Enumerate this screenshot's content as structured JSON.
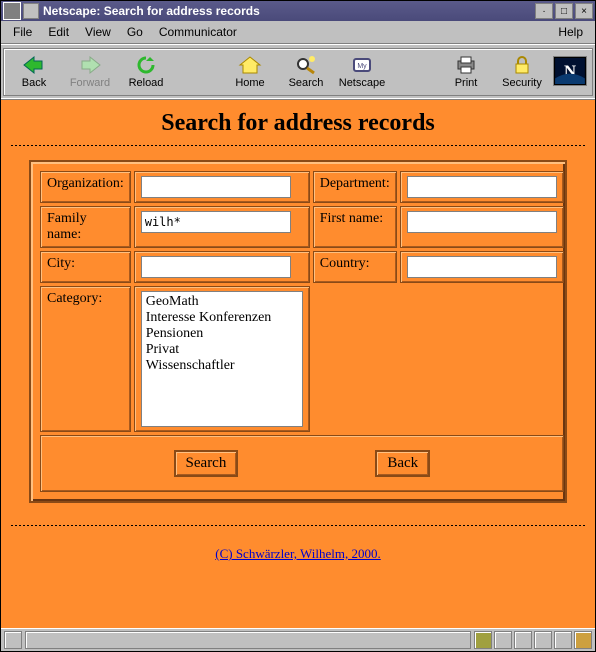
{
  "window": {
    "title": "Netscape: Search for address records"
  },
  "menubar": {
    "file": "File",
    "edit": "Edit",
    "view": "View",
    "go": "Go",
    "communicator": "Communicator",
    "help": "Help"
  },
  "toolbar": {
    "back": "Back",
    "forward": "Forward",
    "reload": "Reload",
    "home": "Home",
    "search": "Search",
    "netscape": "Netscape",
    "print": "Print",
    "security": "Security"
  },
  "page": {
    "title": "Search for address records"
  },
  "form": {
    "labels": {
      "organization": "Organization:",
      "department": "Department:",
      "family_name": "Family name:",
      "first_name": "First name:",
      "city": "City:",
      "country": "Country:",
      "category": "Category:"
    },
    "values": {
      "organization": "",
      "department": "",
      "family_name": "wilh*",
      "first_name": "",
      "city": "",
      "country": ""
    },
    "category_options": [
      "GeoMath",
      "Interesse Konferenzen",
      "Pensionen",
      "Privat",
      "Wissenschaftler"
    ],
    "buttons": {
      "search": "Search",
      "back": "Back"
    }
  },
  "footer": {
    "copyright": "(C) Schwärzler, Wilhelm, 2000."
  }
}
